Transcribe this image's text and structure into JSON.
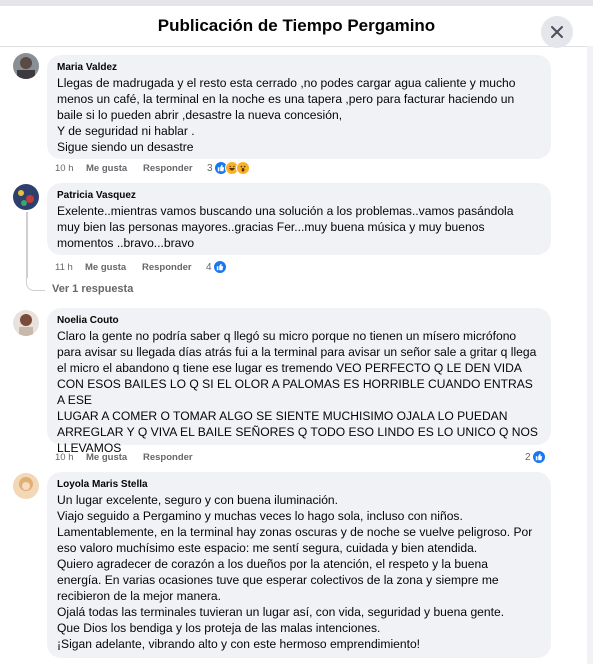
{
  "header": {
    "title": "Publicación de Tiempo Pergamino"
  },
  "comments": [
    {
      "author": "Maria Valdez",
      "lines": [
        "Llegas de madrugada y el resto esta cerrado ,no podes cargar agua caliente y mucho",
        "menos un café, la terminal en la noche es una tapera ,pero para facturar haciendo un",
        "baile si lo pueden abrir ,desastre la nueva concesión,",
        "Y de seguridad ni hablar .",
        "Sigue siendo un desastre"
      ],
      "time": "10 h",
      "like_label": "Me gusta",
      "reply_label": "Responder",
      "reactions_count": "3",
      "reactions": [
        "like-icon",
        "haha-icon",
        "wow-icon"
      ]
    },
    {
      "author": "Patricia Vasquez",
      "lines": [
        "Exelente..mientras vamos buscando una solución a los problemas..vamos pasándola",
        "muy bien las personas mayores..gracias Fer...muy buena música y muy buenos",
        "momentos ..bravo...bravo"
      ],
      "time": "11 h",
      "like_label": "Me gusta",
      "reply_label": "Responder",
      "reactions_count": "4",
      "reactions": [
        "like-icon"
      ],
      "replies_link": "Ver 1 respuesta"
    },
    {
      "author": "Noelia Couto",
      "lines": [
        "Claro la gente no podría saber q llegó su micro porque no tienen un mísero micrófono",
        "para avisar su llegada días atrás fui a la terminal para avisar un señor sale a gritar q llega",
        "el micro el abandono q tiene ese lugar es tremendo VEO PERFECTO Q LE DEN VIDA",
        "CON ESOS BAILES LO Q SI EL OLOR A PALOMAS ES HORRIBLE CUANDO ENTRAS A ESE",
        "LUGAR A COMER O TOMAR ALGO SE SIENTE MUCHISIMO OJALA LO PUEDAN",
        "ARREGLAR Y Q VIVA EL BAILE SEÑORES Q TODO ESO LINDO ES LO UNICO Q NOS",
        "LLEVAMOS"
      ],
      "time": "10 h",
      "like_label": "Me gusta",
      "reply_label": "Responder",
      "reactions_count": "2",
      "reactions": [
        "like-icon"
      ]
    },
    {
      "author": "Loyola Maris Stella",
      "lines": [
        "Un lugar excelente, seguro y con buena iluminación.",
        "Viajo seguido a Pergamino y muchas veces lo hago sola, incluso con niños.",
        "Lamentablemente, en la terminal hay zonas oscuras y de noche se vuelve peligroso. Por",
        "eso valoro muchísimo este espacio: me sentí segura, cuidada y bien atendida.",
        "Quiero agradecer de corazón a los dueños por la atención, el respeto y la buena",
        "energía. En varias ocasiones tuve que esperar colectivos de la zona y siempre me",
        "recibieron de la mejor manera.",
        "Ojalá todas las terminales tuvieran un lugar así, con vida, seguridad y buena gente.",
        "Que Dios los bendiga y los proteja de las malas intenciones.",
        "¡Sigan adelante, vibrando alto y con este hermoso emprendimiento!"
      ]
    }
  ]
}
